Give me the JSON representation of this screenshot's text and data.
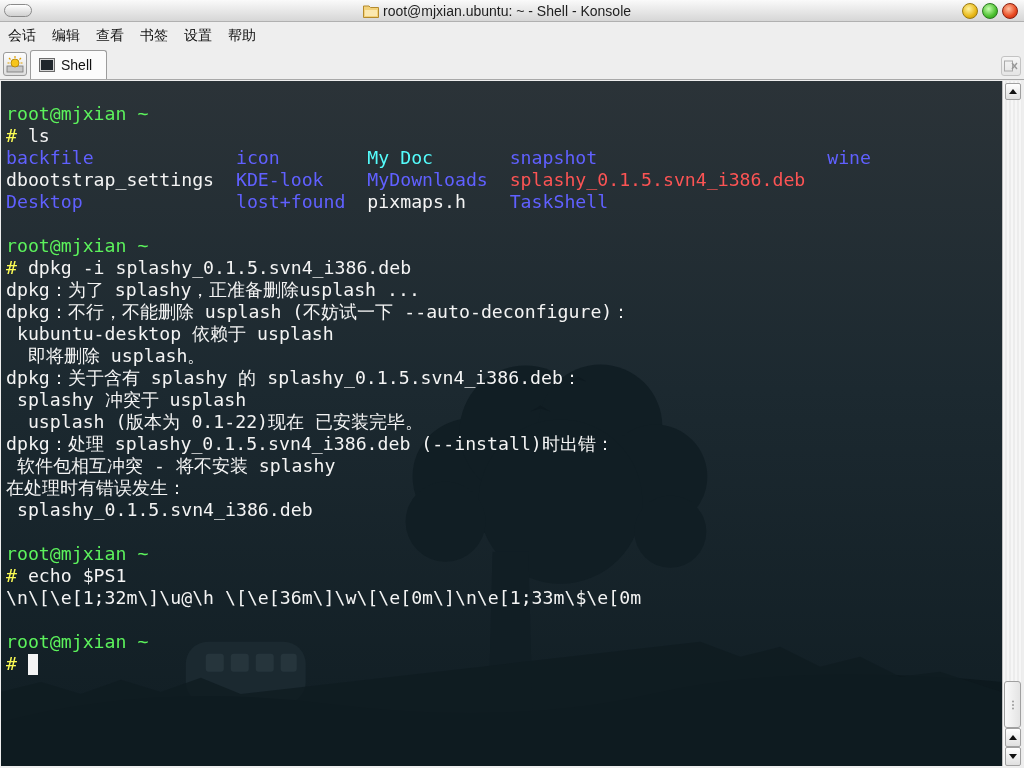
{
  "window": {
    "title": "root@mjxian.ubuntu: ~ - Shell - Konsole"
  },
  "menu_bar": {
    "items": [
      "会话",
      "编辑",
      "查看",
      "书签",
      "设置",
      "帮助"
    ]
  },
  "tab_bar": {
    "tabs": [
      {
        "label": "Shell",
        "selected": true
      }
    ],
    "close_tab_button": {
      "disabled": true
    }
  },
  "terminal": {
    "lines": [
      {
        "kind": "blank"
      },
      {
        "kind": "prompt",
        "text": "root@mjxian ~"
      },
      {
        "kind": "command",
        "symbol": "#",
        "text": "ls"
      },
      {
        "kind": "listing",
        "entries": [
          {
            "name": "backfile",
            "color": "#6060ff"
          },
          {
            "name": "icon",
            "color": "#6060ff"
          },
          {
            "name": "My Doc",
            "color": "#54fcfc"
          },
          {
            "name": "snapshot",
            "color": "#6060ff"
          },
          {
            "name": "wine",
            "color": "#6060ff"
          }
        ]
      },
      {
        "kind": "listing",
        "entries": [
          {
            "name": "dbootstrap_settings",
            "color": "#f4f4f4"
          },
          {
            "name": "KDE-look",
            "color": "#6060ff"
          },
          {
            "name": "MyDownloads",
            "color": "#6060ff"
          },
          {
            "name": "splashy_0.1.5.svn4_i386.deb",
            "color": "#fc5454"
          }
        ]
      },
      {
        "kind": "listing",
        "entries": [
          {
            "name": "Desktop",
            "color": "#6060ff"
          },
          {
            "name": "lost+found",
            "color": "#6060ff"
          },
          {
            "name": "pixmaps.h",
            "color": "#f4f4f4"
          },
          {
            "name": "TaskShell",
            "color": "#6060ff"
          }
        ]
      },
      {
        "kind": "blank"
      },
      {
        "kind": "prompt",
        "text": "root@mjxian ~"
      },
      {
        "kind": "command",
        "symbol": "#",
        "text": "dpkg -i splashy_0.1.5.svn4_i386.deb"
      },
      {
        "kind": "output",
        "text": "dpkg：为了 splashy，正准备删除usplash ..."
      },
      {
        "kind": "output",
        "text": "dpkg：不行，不能删除 usplash (不妨试一下 --auto-deconfigure)："
      },
      {
        "kind": "output",
        "text": " kubuntu-desktop 依赖于 usplash"
      },
      {
        "kind": "output",
        "text": "  即将删除 usplash。"
      },
      {
        "kind": "output",
        "text": "dpkg：关于含有 splashy 的 splashy_0.1.5.svn4_i386.deb："
      },
      {
        "kind": "output",
        "text": " splashy 冲突于 usplash"
      },
      {
        "kind": "output",
        "text": "  usplash (版本为 0.1-22)现在 已安装完毕。"
      },
      {
        "kind": "output",
        "text": "dpkg：处理 splashy_0.1.5.svn4_i386.deb (--install)时出错："
      },
      {
        "kind": "output",
        "text": " 软件包相互冲突 - 将不安装 splashy"
      },
      {
        "kind": "output",
        "text": "在处理时有错误发生："
      },
      {
        "kind": "output",
        "text": " splashy_0.1.5.svn4_i386.deb"
      },
      {
        "kind": "blank"
      },
      {
        "kind": "prompt",
        "text": "root@mjxian ~"
      },
      {
        "kind": "command",
        "symbol": "#",
        "text": "echo $PS1"
      },
      {
        "kind": "output",
        "text": "\\n\\[\\e[1;32m\\]\\u@\\h \\[\\e[36m\\]\\w\\[\\e[0m\\]\\n\\e[1;33m\\$\\e[0m"
      },
      {
        "kind": "blank"
      },
      {
        "kind": "prompt",
        "text": "root@mjxian ~"
      },
      {
        "kind": "input",
        "symbol": "#",
        "cursor": true
      }
    ]
  }
}
